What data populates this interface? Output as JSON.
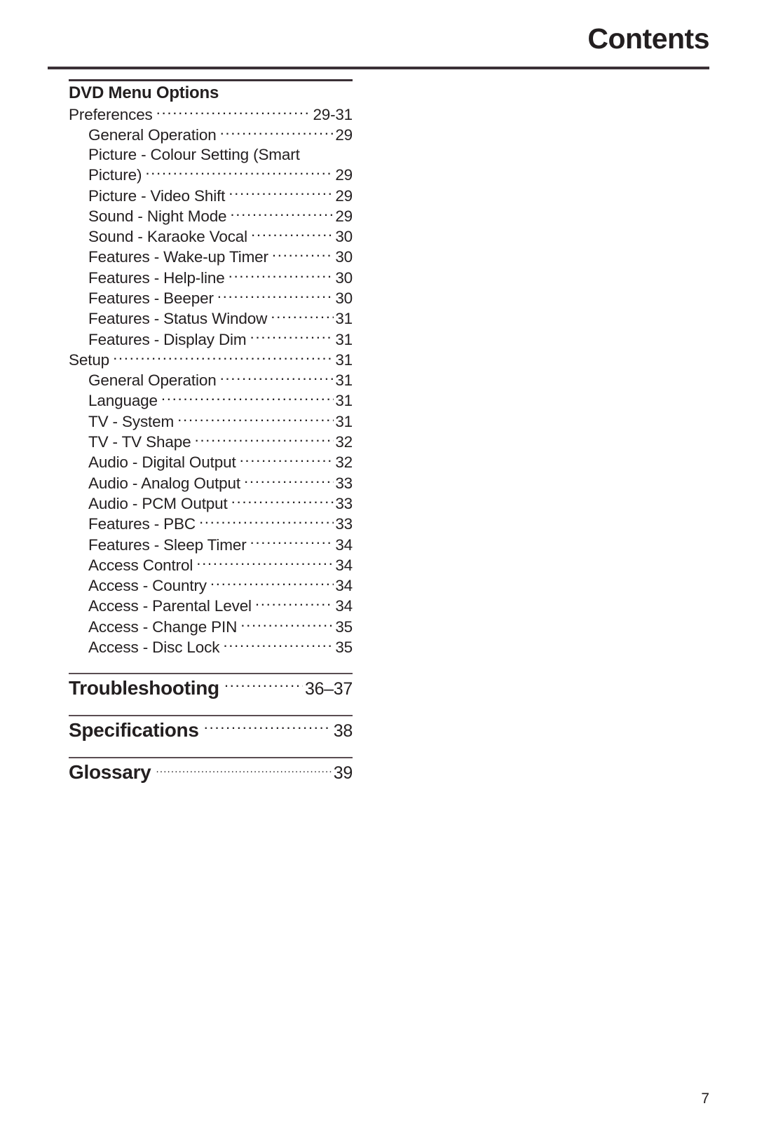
{
  "header": {
    "title": "Contents"
  },
  "toc": {
    "group": {
      "title": "DVD Menu Options",
      "entries": [
        {
          "label": "Preferences",
          "page": "29-31",
          "level": 1
        },
        {
          "label": "General Operation",
          "page": "29",
          "level": 2
        },
        {
          "label": "Picture - Colour Setting (Smart",
          "page": "",
          "level": 2,
          "continued": true
        },
        {
          "label": "Picture)",
          "page": "29",
          "level": 2
        },
        {
          "label": "Picture - Video Shift",
          "page": "29",
          "level": 2
        },
        {
          "label": "Sound - Night Mode",
          "page": "29",
          "level": 2
        },
        {
          "label": "Sound -  Karaoke Vocal",
          "page": "30",
          "level": 2
        },
        {
          "label": "Features - Wake-up Timer",
          "page": "30",
          "level": 2
        },
        {
          "label": "Features - Help-line",
          "page": "30",
          "level": 2
        },
        {
          "label": "Features - Beeper",
          "page": "30",
          "level": 2
        },
        {
          "label": "Features - Status Window",
          "page": "31",
          "level": 2
        },
        {
          "label": "Features - Display Dim",
          "page": "31",
          "level": 2
        },
        {
          "label": "Setup",
          "page": "31",
          "level": 1
        },
        {
          "label": "General Operation",
          "page": "31",
          "level": 2
        },
        {
          "label": "Language",
          "page": "31",
          "level": 2
        },
        {
          "label": "TV - System",
          "page": "31",
          "level": 2
        },
        {
          "label": "TV - TV Shape",
          "page": "32",
          "level": 2
        },
        {
          "label": "Audio - Digital Output",
          "page": "32",
          "level": 2
        },
        {
          "label": "Audio - Analog Output",
          "page": "33",
          "level": 2
        },
        {
          "label": "Audio - PCM Output",
          "page": "33",
          "level": 2
        },
        {
          "label": "Features - PBC",
          "page": "33",
          "level": 2
        },
        {
          "label": "Features - Sleep Timer",
          "page": "34",
          "level": 2
        },
        {
          "label": "Access Control",
          "page": "34",
          "level": 2
        },
        {
          "label": "Access - Country",
          "page": "34",
          "level": 2
        },
        {
          "label": "Access - Parental Level",
          "page": "34",
          "level": 2
        },
        {
          "label": "Access - Change PIN",
          "page": "35",
          "level": 2
        },
        {
          "label": "Access - Disc Lock",
          "page": "35",
          "level": 2
        }
      ]
    },
    "sections": [
      {
        "label": "Troubleshooting",
        "page": "36–37",
        "leader": "normal"
      },
      {
        "label": "Specifications",
        "page": "38",
        "leader": "normal"
      },
      {
        "label": "Glossary",
        "page": "39",
        "leader": "fine"
      }
    ]
  },
  "footer": {
    "page_number": "7"
  },
  "colors": {
    "text": "#231f20",
    "rule": "#3b3036",
    "background": "#ffffff"
  }
}
